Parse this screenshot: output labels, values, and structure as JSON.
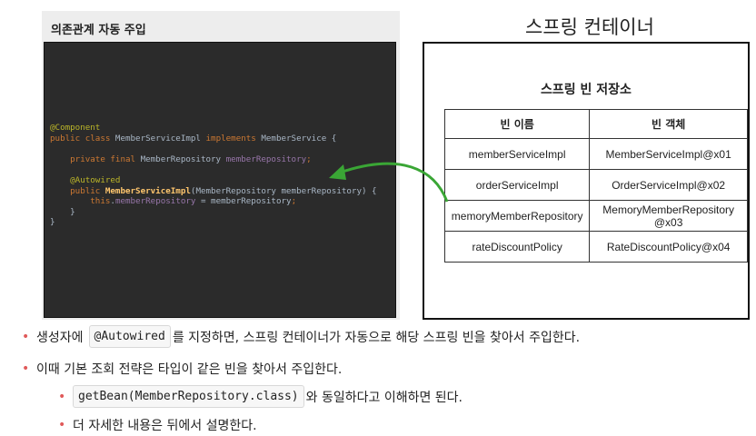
{
  "diagram": {
    "left_label": "의존관계 자동 주입",
    "right_label": "스프링 컨테이너",
    "store_title": "스프링 빈 저장소",
    "code_lines": [
      [
        {
          "t": "@Component",
          "c": "ann"
        }
      ],
      [
        {
          "t": "public class ",
          "c": "kw"
        },
        {
          "t": "MemberServiceImpl ",
          "c": ""
        },
        {
          "t": "implements ",
          "c": "kw"
        },
        {
          "t": "MemberService {",
          "c": ""
        }
      ],
      [],
      [
        {
          "t": "    private final ",
          "c": "kw"
        },
        {
          "t": "MemberRepository ",
          "c": ""
        },
        {
          "t": "memberRepository",
          "c": "fld"
        },
        {
          "t": ";",
          "c": "kw"
        }
      ],
      [],
      [
        {
          "t": "    @Autowired",
          "c": "ann"
        }
      ],
      [
        {
          "t": "    public ",
          "c": "kw"
        },
        {
          "t": "MemberServiceImpl",
          "c": "mth"
        },
        {
          "t": "(MemberRepository memberRepository) {",
          "c": ""
        }
      ],
      [
        {
          "t": "        this",
          "c": "kw"
        },
        {
          "t": ".",
          "c": ""
        },
        {
          "t": "memberRepository",
          "c": "fld"
        },
        {
          "t": " = memberRepository",
          "c": ""
        },
        {
          "t": ";",
          "c": "kw"
        }
      ],
      [
        {
          "t": "    }",
          "c": ""
        }
      ],
      [
        {
          "t": "}",
          "c": ""
        }
      ]
    ],
    "table": {
      "headers": [
        "빈 이름",
        "빈 객체"
      ],
      "rows": [
        [
          "memberServiceImpl",
          "MemberServiceImpl@x01"
        ],
        [
          "orderServiceImpl",
          "OrderServiceImpl@x02"
        ],
        [
          "memoryMemberRepository",
          "MemoryMemberRepository @x03"
        ],
        [
          "rateDiscountPolicy",
          "RateDiscountPolicy@x04"
        ]
      ]
    },
    "arrow_color": "#3aa635"
  },
  "bullets": {
    "b1_code": "@Autowired",
    "b1_text": "를 지정하면, 스프링 컨테이너가 자동으로 해당 스프링 빈을 찾아서 주입한다.",
    "b1_prefix": "생성자에",
    "b2_text": "이때 기본 조회 전략은 타입이 같은 빈을 찾아서 주입한다.",
    "b3_code": "getBean(MemberRepository.class)",
    "b3_text": "와 동일하다고 이해하면 된다.",
    "b4_text": "더 자세한 내용은 뒤에서 설명한다.",
    "bullet_color": "#e05a5a"
  }
}
